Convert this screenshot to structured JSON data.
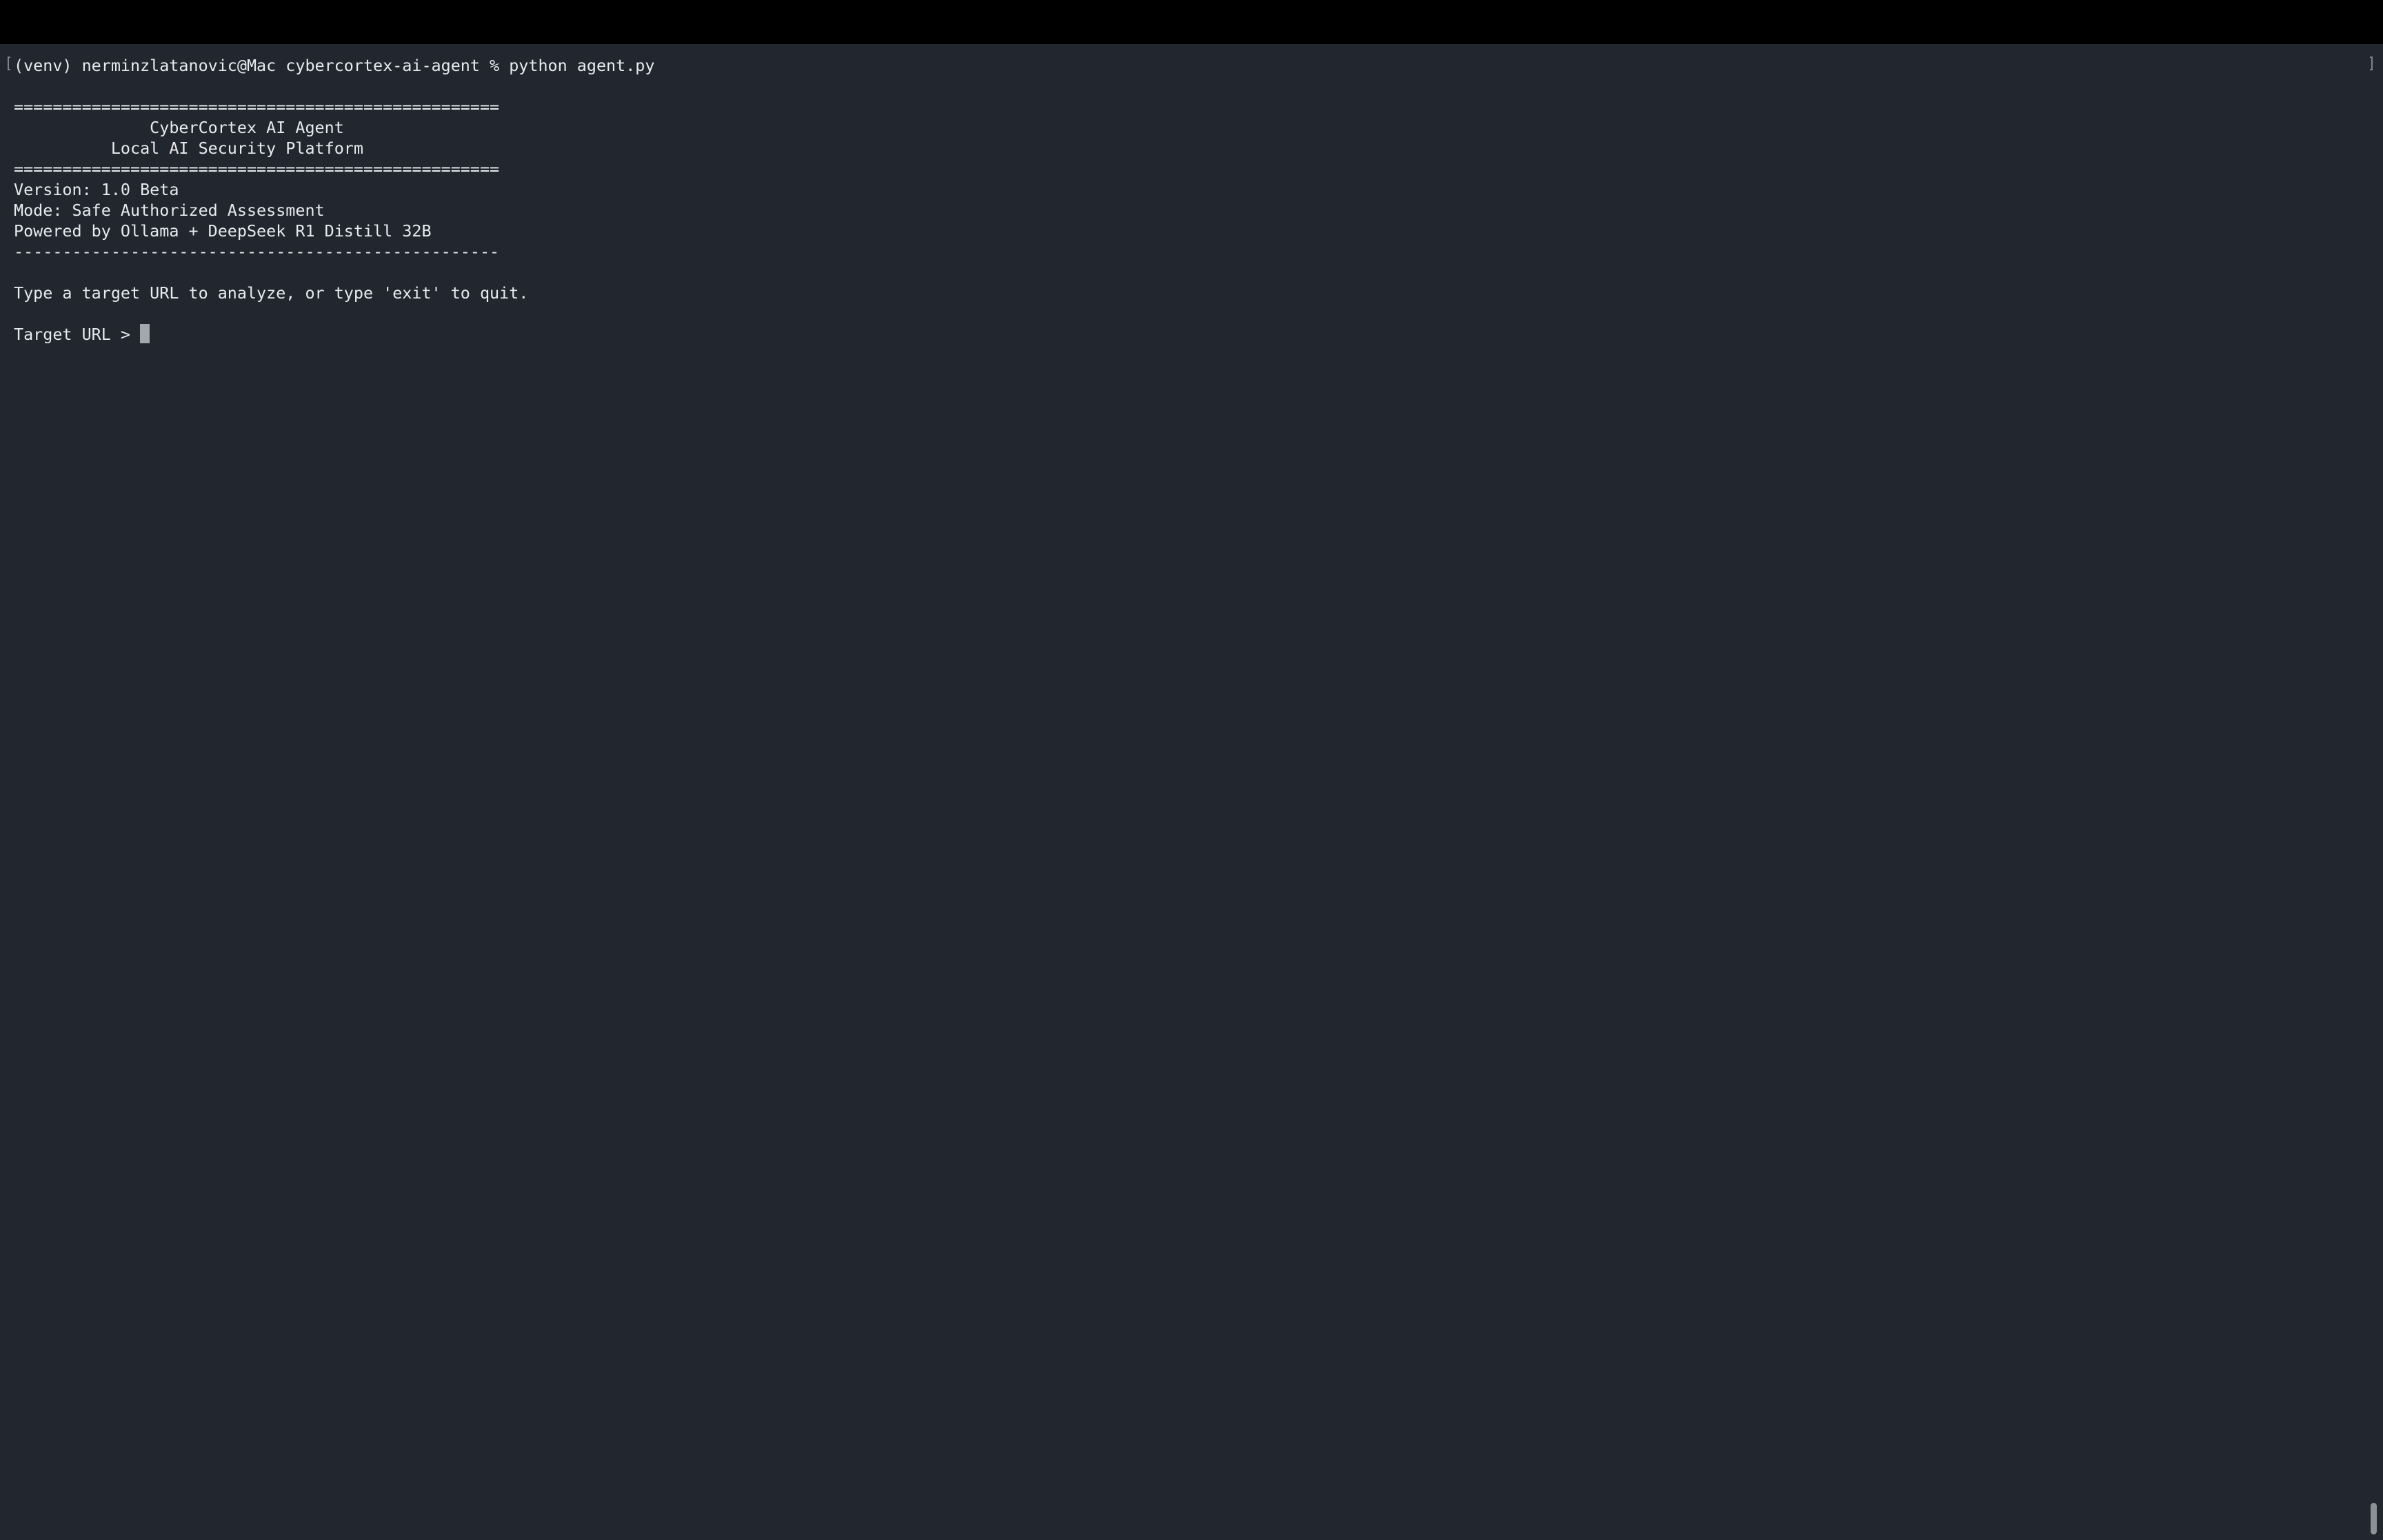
{
  "terminal": {
    "lines": [
      "(venv) nerminzlatanovic@Mac cybercortex-ai-agent % python agent.py",
      "==================================================",
      "              CyberCortex AI Agent",
      "          Local AI Security Platform",
      "==================================================",
      "Version: 1.0 Beta",
      "Mode: Safe Authorized Assessment",
      "Powered by Ollama + DeepSeek R1 Distill 32B",
      "--------------------------------------------------",
      "Type a target URL to analyze, or type 'exit' to quit.",
      "Target URL > "
    ]
  }
}
